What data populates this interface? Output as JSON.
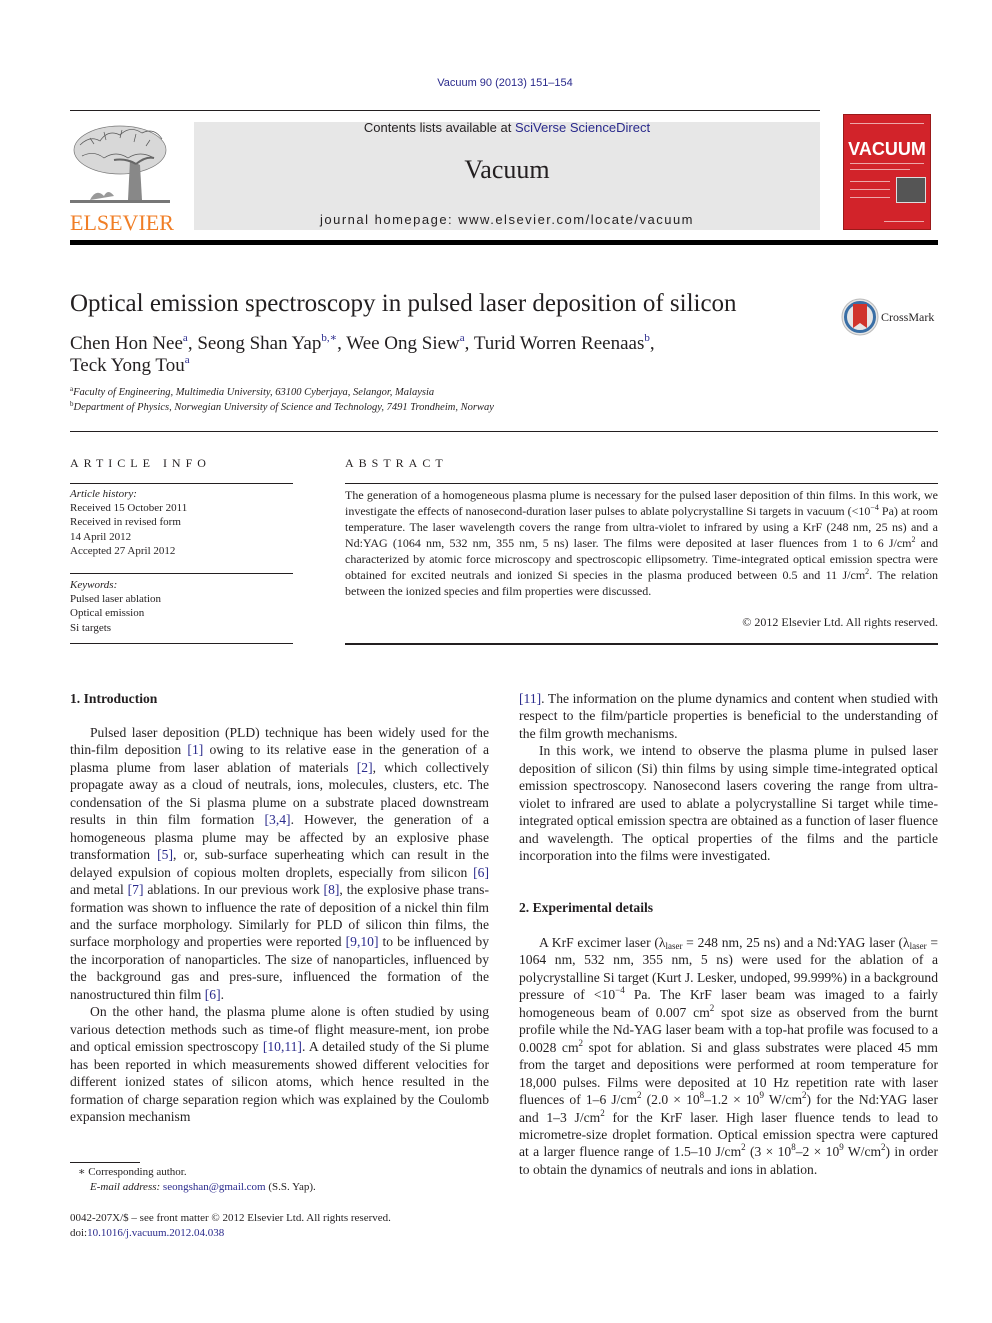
{
  "header": {
    "citation": "Vacuum 90 (2013) 151–154",
    "contents_prefix": "Contents lists available at ",
    "contents_link": "SciVerse ScienceDirect",
    "journal_name": "Vacuum",
    "homepage": "journal homepage: www.elsevier.com/locate/vacuum",
    "publisher_logo_text": "ELSEVIER",
    "cover_title": "VACUUM",
    "crossmark_label": "CrossMark"
  },
  "colors": {
    "link": "#2a2a8c",
    "elsevier_orange": "#f07e26",
    "cover_red": "#d2232a",
    "journal_box": "#e7e7e7"
  },
  "article": {
    "title": "Optical emission spectroscopy in pulsed laser deposition of silicon",
    "authors": [
      {
        "name": "Chen Hon Nee",
        "sup": "a"
      },
      {
        "name": "Seong Shan Yap",
        "sup": "b,∗"
      },
      {
        "name": "Wee Ong Siew",
        "sup": "a"
      },
      {
        "name": "Turid Worren Reenaas",
        "sup": "b"
      },
      {
        "name": "Teck Yong Tou",
        "sup": "a"
      }
    ],
    "affiliations": [
      {
        "key": "a",
        "text": "Faculty of Engineering, Multimedia University, 63100 Cyberjaya, Selangor, Malaysia"
      },
      {
        "key": "b",
        "text": "Department of Physics, Norwegian University of Science and Technology, 7491 Trondheim, Norway"
      }
    ]
  },
  "article_info": {
    "heading": "ARTICLE INFO",
    "history_label": "Article history:",
    "history": [
      "Received 15 October 2011",
      "Received in revised form",
      "14 April 2012",
      "Accepted 27 April 2012"
    ],
    "keywords_label": "Keywords:",
    "keywords": [
      "Pulsed laser ablation",
      "Optical emission",
      "Si targets"
    ]
  },
  "abstract": {
    "heading": "ABSTRACT",
    "p1": "The generation of a homogeneous plasma plume is necessary for the pulsed laser deposition of thin films. In this work, we investigate the effects of nanosecond-duration laser pulses to ablate polycrystalline Si targets in vacuum (<10",
    "p1_sup": "−4",
    "p2": " Pa) at room temperature. The laser wavelength covers the range from ultra-violet to infrared by using a KrF (248 nm, 25 ns) and a Nd:YAG (1064 nm, 532 nm, 355 nm, 5 ns) laser. The films were deposited at laser fluences from 1 to 6 J/cm",
    "p3": " and characterized by atomic force microscopy and spectroscopic ellipsometry. Time-integrated optical emission spectra were obtained for excited neutrals and ionized Si species in the plasma produced between 0.5 and 11 J/cm",
    "p4": ". The relation between the ionized species and film properties were discussed.",
    "sq": "2",
    "copyright": "© 2012 Elsevier Ltd. All rights reserved."
  },
  "intro": {
    "heading": "1.  Introduction",
    "para1": [
      {
        "t": "Pulsed laser deposition (PLD) technique has been widely used for the thin-film deposition "
      },
      {
        "ref": "[1]"
      },
      {
        "t": " owing to its relative ease in the generation of a plasma plume from laser ablation of materials "
      },
      {
        "ref": "[2]"
      },
      {
        "t": ", which collectively propagate away as a cloud of neutrals, ions, molecules, clusters, etc. The condensation of the Si plasma plume on a substrate placed downstream results in thin film formation "
      },
      {
        "ref": "[3,4]"
      },
      {
        "t": ". However, the generation of a homogeneous plasma plume may be affected by an explosive phase transformation "
      },
      {
        "ref": "[5]"
      },
      {
        "t": ", or, sub-surface superheating which can result in the delayed expulsion of copious molten droplets, especially from silicon "
      },
      {
        "ref": "[6]"
      },
      {
        "t": " and metal "
      },
      {
        "ref": "[7]"
      },
      {
        "t": " ablations. In our previous work "
      },
      {
        "ref": "[8]"
      },
      {
        "t": ", the explosive phase trans-formation was shown to influence the rate of deposition of a nickel thin film and the surface morphology. Similarly for PLD of silicon thin films, the surface morphology and properties were reported "
      },
      {
        "ref": "[9,10]"
      },
      {
        "t": " to be influenced by the incorporation of nanoparticles. The size of nanoparticles, influenced by the background gas and pres-sure, influenced the formation of the nanostructured thin film "
      },
      {
        "ref": "[6]"
      },
      {
        "t": "."
      }
    ],
    "para2": [
      {
        "t": "On the other hand, the plasma plume alone is often studied by using various detection methods such as time-of flight measure-ment, ion probe and optical emission spectroscopy "
      },
      {
        "ref": "[10,11]"
      },
      {
        "t": ". A detailed study of the Si plume has been reported in which measurements showed different velocities for different ionized states of silicon atoms, which hence resulted in the formation of charge separation region which was explained by the Coulomb expansion mechanism"
      }
    ],
    "para2_cont": [
      {
        "ref": "[11]"
      },
      {
        "t": ". The information on the plume dynamics and content when studied with respect to the film/particle properties is beneficial to the understanding of the film growth mechanisms."
      }
    ],
    "para3": "In this work, we intend to observe the plasma plume in pulsed laser deposition of silicon (Si) thin films by using simple time-integrated optical emission spectroscopy. Nanosecond lasers covering the range from ultra-violet to infrared are used to ablate a polycrystalline Si target while time-integrated optical emission spectra are obtained as a function of laser fluence and wavelength. The optical properties of the films and the particle incorporation into the films were investigated."
  },
  "experimental": {
    "heading": "2.  Experimental details",
    "segments": [
      {
        "t": "A KrF excimer laser (λ"
      },
      {
        "sub": "laser"
      },
      {
        "t": " = 248 nm, 25 ns) and a Nd:YAG laser (λ"
      },
      {
        "sub": "laser"
      },
      {
        "t": " = 1064 nm, 532 nm, 355 nm, 5 ns) were used for the ablation of a polycrystalline Si target (Kurt J. Lesker, undoped, 99.999%) in a background pressure of <10"
      },
      {
        "sup": "−4"
      },
      {
        "t": " Pa. The KrF laser beam was imaged to a fairly homogeneous beam of 0.007 cm"
      },
      {
        "sup": "2"
      },
      {
        "t": " spot size as observed from the burnt profile while the Nd-YAG laser beam with a top-hat profile was focused to a 0.0028 cm"
      },
      {
        "sup": "2"
      },
      {
        "t": " spot for ablation. Si and glass substrates were placed 45 mm from the target and depositions were performed at room temperature for 18,000 pulses. Films were deposited at 10 Hz repetition rate with laser fluences of 1–6 J/cm"
      },
      {
        "sup": "2"
      },
      {
        "t": " (2.0 × 10"
      },
      {
        "sup": "8"
      },
      {
        "t": "–1.2 × 10"
      },
      {
        "sup": "9"
      },
      {
        "t": " W/cm"
      },
      {
        "sup": "2"
      },
      {
        "t": ") for the Nd:YAG laser and 1–3 J/cm"
      },
      {
        "sup": "2"
      },
      {
        "t": " for the KrF laser. High laser fluence tends to lead to micrometre-size droplet formation. Optical emission spectra were captured at a larger fluence range of 1.5–10 J/cm"
      },
      {
        "sup": "2"
      },
      {
        "t": " (3 × 10"
      },
      {
        "sup": "8"
      },
      {
        "t": "–2 × 10"
      },
      {
        "sup": "9"
      },
      {
        "t": " W/cm"
      },
      {
        "sup": "2"
      },
      {
        "t": ") in order to obtain the dynamics of neutrals and ions in ablation."
      }
    ]
  },
  "footnotes": {
    "corresponding": "∗  Corresponding author.",
    "email_label": "E-mail address: ",
    "email": "seongshan@gmail.com",
    "email_suffix": " (S.S. Yap).",
    "issn": "0042-207X/$ – see front matter © 2012 Elsevier Ltd. All rights reserved.",
    "doi_label": "doi:",
    "doi": "10.1016/j.vacuum.2012.04.038"
  }
}
